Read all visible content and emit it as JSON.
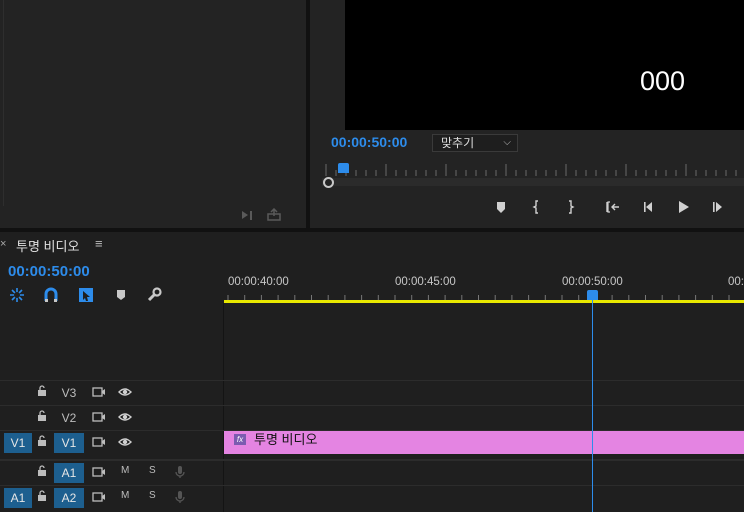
{
  "program_monitor": {
    "overlay_text": "000",
    "timecode": "00:00:50:00",
    "fit_label": "맞추기"
  },
  "timeline": {
    "close_glyph": "×",
    "sequence_name": "투명 비디오",
    "menu_glyph": "≡",
    "timecode": "00:00:50:00",
    "ruler_labels": [
      "00:00:40:00",
      "00:00:45:00",
      "00:00:50:00",
      "00:0"
    ],
    "tracks": [
      {
        "name": "V3",
        "source": ""
      },
      {
        "name": "V2",
        "source": ""
      },
      {
        "name": "V1",
        "source": "V1"
      },
      {
        "name": "A1",
        "source": "",
        "m": "M",
        "s": "S"
      },
      {
        "name": "A2",
        "source": "A1",
        "m": "M",
        "s": "S"
      }
    ],
    "clip": {
      "label": "투명 비디오",
      "fx": "fx",
      "color": "#e484e2"
    }
  },
  "colors": {
    "accent": "#2d8ceb",
    "work_area": "#e8e800",
    "track_target": "#1d5f8f"
  }
}
